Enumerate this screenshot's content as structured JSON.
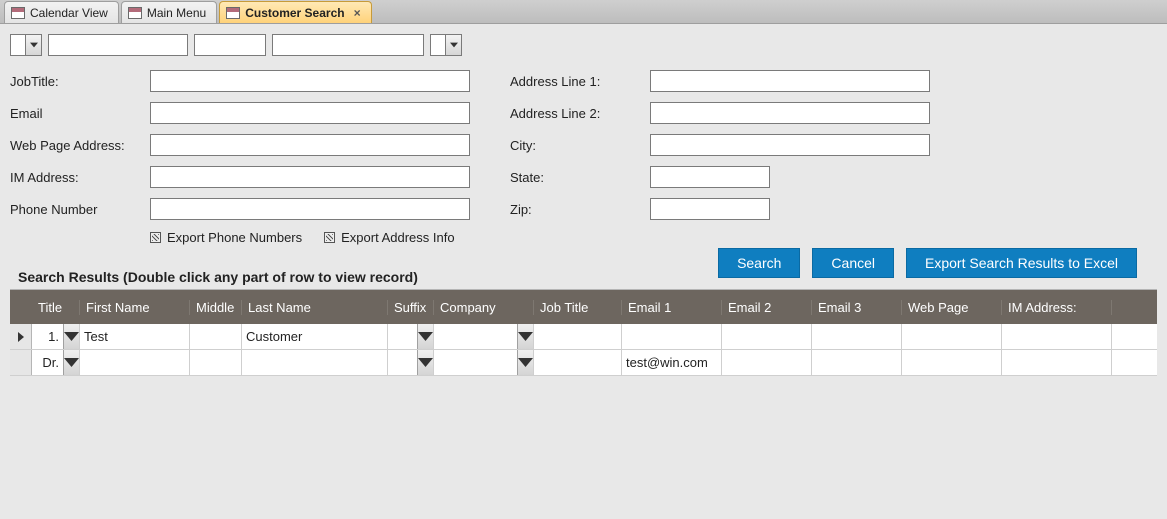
{
  "tabs": [
    {
      "label": "Calendar View",
      "active": false
    },
    {
      "label": "Main Menu",
      "active": false
    },
    {
      "label": "Customer Search",
      "active": true
    }
  ],
  "form": {
    "left": {
      "job_title_lbl": "JobTitle:",
      "email_lbl": "Email",
      "web_lbl": "Web Page Address:",
      "im_lbl": "IM Address:",
      "phone_lbl": "Phone Number",
      "job_title": "",
      "email": "",
      "web": "",
      "im": "",
      "phone": ""
    },
    "right": {
      "addr1_lbl": "Address Line 1:",
      "addr2_lbl": "Address Line 2:",
      "city_lbl": "City:",
      "state_lbl": "State:",
      "zip_lbl": "Zip:",
      "addr1": "",
      "addr2": "",
      "city": "",
      "state": "",
      "zip": ""
    },
    "export_phone_lbl": "Export Phone Numbers",
    "export_addr_lbl": "Export Address Info"
  },
  "buttons": {
    "search": "Search",
    "cancel": "Cancel",
    "export": "Export Search Results to Excel"
  },
  "results": {
    "title": "Search Results (Double click any part of row to view record)",
    "columns": {
      "title": "Title",
      "first": "First Name",
      "middle": "Middle",
      "last": "Last Name",
      "suffix": "Suffix",
      "company": "Company",
      "job": "Job Title",
      "em1": "Email 1",
      "em2": "Email 2",
      "em3": "Email 3",
      "web": "Web Page",
      "im": "IM Address:"
    },
    "rows": [
      {
        "selected": true,
        "title": "1.",
        "first": "Test",
        "middle": "",
        "last": "Customer",
        "suffix": "",
        "company": "",
        "job": "",
        "em1": "",
        "em2": "",
        "em3": "",
        "web": "",
        "im": ""
      },
      {
        "selected": false,
        "title": "Dr.",
        "first": "",
        "middle": "",
        "last": "",
        "suffix": "",
        "company": "",
        "job": "",
        "em1": "test@win.com",
        "em2": "",
        "em3": "",
        "web": "",
        "im": ""
      }
    ]
  }
}
